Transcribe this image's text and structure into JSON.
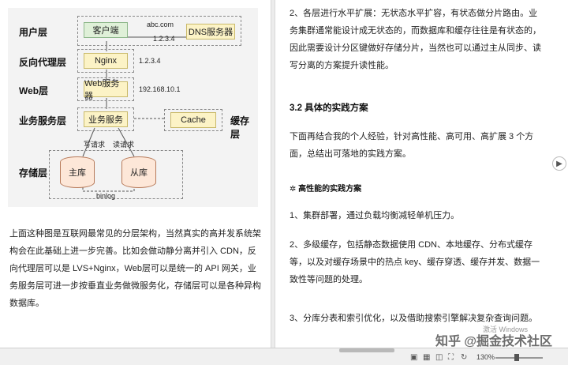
{
  "diagram": {
    "layers": {
      "user": "用户层",
      "proxy": "反向代理层",
      "web": "Web层",
      "service": "业务服务层",
      "storage": "存储层",
      "cache_layer": "缓存层"
    },
    "nodes": {
      "client": "客户端",
      "dns": "DNS服务器",
      "nginx": "Nginx",
      "web_server": "Web服务器",
      "biz_service": "业务服务",
      "cache": "Cache",
      "master_db": "主库",
      "slave_db": "从库"
    },
    "labels": {
      "domain": "abc.com",
      "ip1": "1.2.3.4",
      "ip2": "1.2.3.4",
      "ip3": "192.168.10.1",
      "write_req": "写请求",
      "read_req": "读请求",
      "binlog": "binlog"
    }
  },
  "left_text": "上面这种图是互联网最常见的分层架构，当然真实的高并发系统架构会在此基础上进一步完善。比如会做动静分离并引入 CDN，反向代理层可以是 LVS+Nginx，Web层可以是统一的 API 网关，业务服务层可进一步按垂直业务做微服务化，存储层可以是各种异构数据库。",
  "right": {
    "p1": "2、各层进行水平扩展：无状态水平扩容，有状态做分片路由。业务集群通常能设计成无状态的，而数据库和缓存往往是有状态的，因此需要设计分区键做好存储分片，当然也可以通过主从同步、读写分离的方案提升读性能。",
    "h1": "3.2 具体的实践方案",
    "p2": "下面再结合我的个人经验，针对高性能、高可用、高扩展 3 个方面，总结出可落地的实践方案。",
    "h2": "✲ 高性能的实践方案",
    "p3": "1、集群部署，通过负载均衡减轻单机压力。",
    "p4": "2、多级缓存，包括静态数据使用 CDN、本地缓存、分布式缓存等，以及对缓存场景中的热点 key、缓存穿透、缓存并发、数据一致性等问题的处理。",
    "p5": "3、分库分表和索引优化，以及借助搜索引擎解决复杂查询问题。"
  },
  "statusbar": {
    "zoom": "130%",
    "activate": "激活 Windows"
  },
  "watermark": "知乎 @掘金技术社区"
}
